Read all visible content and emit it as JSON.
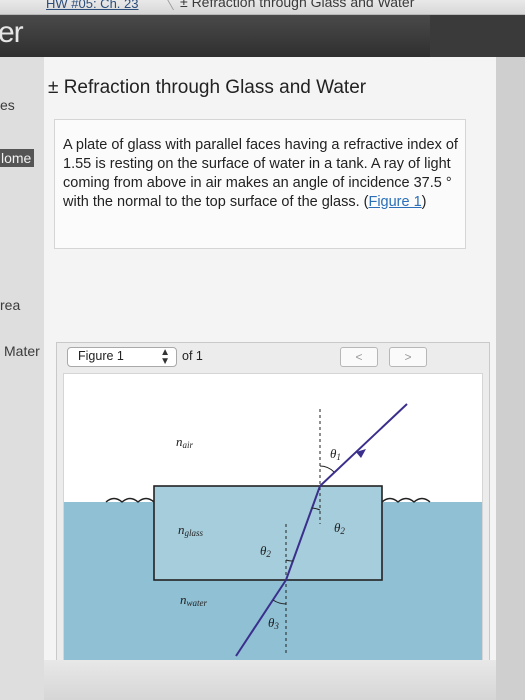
{
  "breadcrumb": {
    "homework": "HW #05: Ch. 23",
    "current": "± Refraction through Glass and Water"
  },
  "band": {
    "title": "er"
  },
  "sidebar": {
    "items": [
      {
        "label": "es"
      },
      {
        "label": "lome"
      },
      {
        "label": "rea"
      },
      {
        "label": "Mater"
      }
    ]
  },
  "problem": {
    "title": "± Refraction through Glass and Water",
    "text_before_link": "A plate of glass with parallel faces having a refractive index of 1.55 is resting on the surface of water in a tank. A ray of light coming from above in air makes an angle of incidence 37.5 ° with the normal to the top surface of the glass. (",
    "link": "Figure 1",
    "text_after_link": ")"
  },
  "figure_panel": {
    "selected_figure": "Figure 1",
    "of_label": "of 1",
    "prev_label": "<",
    "next_label": ">",
    "labels": {
      "n_air": "n",
      "n_air_sub": "air",
      "n_glass": "n",
      "n_glass_sub": "glass",
      "n_water": "n",
      "n_water_sub": "water",
      "theta1": "θ",
      "theta1_sub": "1",
      "theta2_right": "θ",
      "theta2_right_sub": "2",
      "theta2_left": "θ",
      "theta2_left_sub": "2",
      "theta3": "θ",
      "theta3_sub": "3"
    }
  },
  "colors": {
    "water": "#8fc0d4",
    "glass_fill": "#a6cddc",
    "ray": "#3a2f8c",
    "link": "#2a6fb8"
  }
}
